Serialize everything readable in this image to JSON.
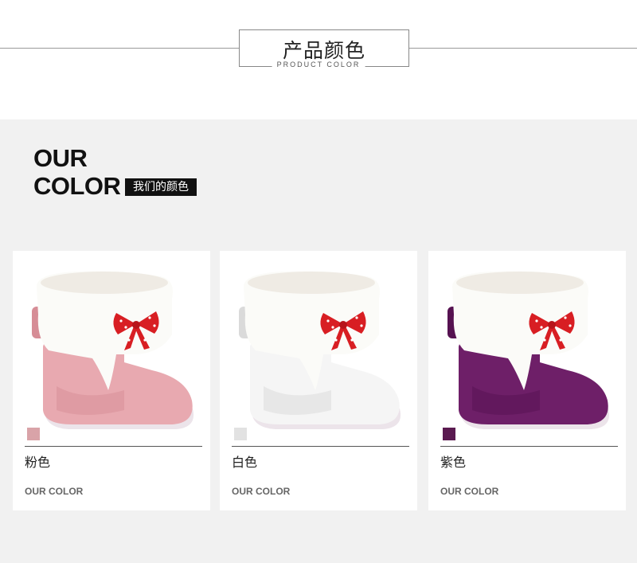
{
  "header": {
    "title_cn": "产品颜色",
    "title_en": "PRODUCT COLOR"
  },
  "section": {
    "heading_line1": "OUR",
    "heading_line2": "COLOR",
    "heading_tag": "我们的颜色"
  },
  "products": [
    {
      "name": "粉色",
      "subtitle": "OUR COLOR",
      "swatch": "#d9a3a8",
      "boot_color": "#e8a9b0",
      "boot_shade": "#d68d96"
    },
    {
      "name": "白色",
      "subtitle": "OUR COLOR",
      "swatch": "#e2e2e2",
      "boot_color": "#f5f5f5",
      "boot_shade": "#dadada"
    },
    {
      "name": "紫色",
      "subtitle": "OUR COLOR",
      "swatch": "#5a1a50",
      "boot_color": "#6e1f68",
      "boot_shade": "#561251"
    }
  ]
}
